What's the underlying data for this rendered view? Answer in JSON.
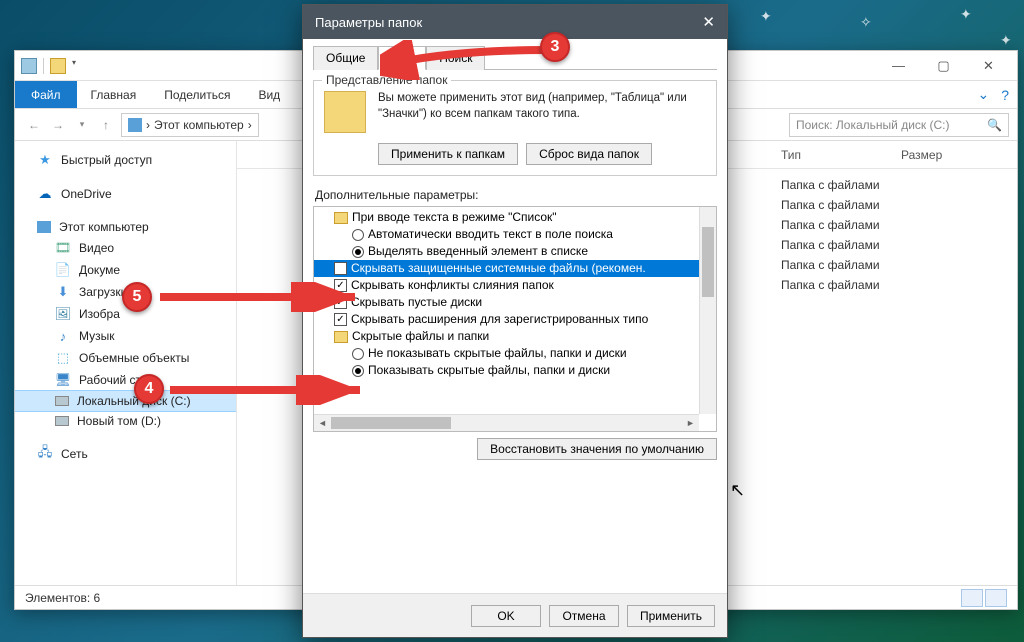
{
  "desktop": {
    "stars": [
      "✦",
      "✦",
      "✧",
      "✦"
    ]
  },
  "explorer": {
    "ribbon": {
      "file": "Файл",
      "home": "Главная",
      "share": "Поделиться",
      "view": "Вид"
    },
    "breadcrumb": {
      "root": "Этот компьютер",
      "sep": "›"
    },
    "search": {
      "placeholder": "Поиск: Локальный диск (C:)"
    },
    "sidebar": {
      "quick": "Быстрый доступ",
      "onedrive": "OneDrive",
      "thispc": "Этот компьютер",
      "children": {
        "video": "Видео",
        "docs": "Докуме",
        "downloads": "Загрузки",
        "pictures": "Изобра",
        "music": "Музык",
        "objects3d": "Объемные объекты",
        "desktop": "Рабочий стол",
        "cdrive": "Локальный диск (C:)",
        "ddrive": "Новый том (D:)"
      },
      "network": "Сеть"
    },
    "columns": {
      "type": "Тип",
      "size": "Размер"
    },
    "rows": [
      "Папка с файлами",
      "Папка с файлами",
      "Папка с файлами",
      "Папка с файлами",
      "Папка с файлами",
      "Папка с файлами"
    ],
    "status": "Элементов: 6"
  },
  "dialog": {
    "title": "Параметры папок",
    "close": "✕",
    "tabs": {
      "general": "Общие",
      "view": "Вид",
      "search": "Поиск"
    },
    "group_title": "Представление папок",
    "desc": "Вы можете применить этот вид (например, \"Таблица\" или \"Значки\") ко всем папкам такого типа.",
    "apply_folders": "Применить к папкам",
    "reset_folders": "Сброс вида папок",
    "adv_label": "Дополнительные параметры:",
    "tree": {
      "r0": "При вводе текста в режиме \"Список\"",
      "r1": "Автоматически вводить текст в поле поиска",
      "r2": "Выделять введенный элемент в списке",
      "r3": "Скрывать защищенные системные файлы (рекомен.",
      "r4": "Скрывать конфликты слияния папок",
      "r5": "Скрывать пустые диски",
      "r6": "Скрывать расширения для зарегистрированных типо",
      "r7": "Скрытые файлы и папки",
      "r8": "Не показывать скрытые файлы, папки и диски",
      "r9": "Показывать скрытые файлы, папки и диски"
    },
    "restore": "Восстановить значения по умолчанию",
    "ok": "OK",
    "cancel": "Отмена",
    "apply": "Применить"
  },
  "pins": {
    "p3": "3",
    "p4": "4",
    "p5": "5"
  }
}
